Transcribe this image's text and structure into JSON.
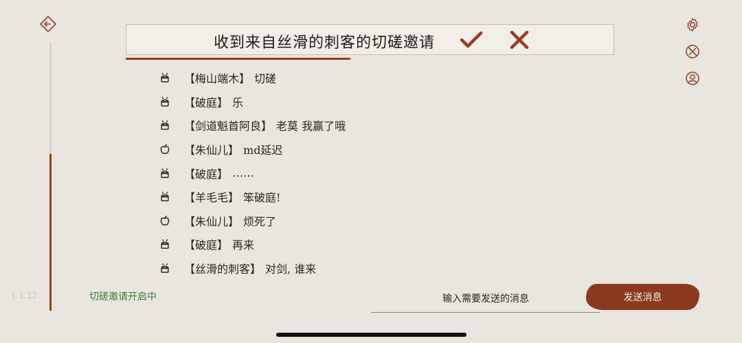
{
  "version": "1.1.12",
  "status_text": "切磋邀请开启中",
  "invite_banner": {
    "text": "收到来自丝滑的刺客的切磋邀请",
    "accept_icon": "check-icon",
    "reject_icon": "cross-icon"
  },
  "icons": {
    "back": "back-arrow-icon",
    "settings": "gear-icon",
    "duel_off": "crossed-swords-off-icon",
    "profile": "user-icon"
  },
  "chat": [
    {
      "device": "android",
      "name": "【梅山端木】",
      "text": "切磋"
    },
    {
      "device": "android",
      "name": "【破庭】",
      "text": "乐"
    },
    {
      "device": "android",
      "name": "【剑道魁首阿良】",
      "text": "老莫 我赢了哦"
    },
    {
      "device": "apple",
      "name": "【朱仙儿】",
      "text": "md延迟"
    },
    {
      "device": "android",
      "name": "【破庭】",
      "text": "……"
    },
    {
      "device": "android",
      "name": "【羊毛毛】",
      "text": "笨破庭!"
    },
    {
      "device": "apple",
      "name": "【朱仙儿】",
      "text": "烦死了"
    },
    {
      "device": "android",
      "name": "【破庭】",
      "text": "再来"
    },
    {
      "device": "android",
      "name": "【丝滑的刺客】",
      "text": "对剑, 谁来"
    }
  ],
  "input": {
    "placeholder": "输入需要发送的消息",
    "value": ""
  },
  "send_label": "发送消息",
  "colors": {
    "accent": "#9b3b22",
    "background": "#e9e6df",
    "status_green": "#3f7a3b",
    "send_button": "#8c3a1f"
  }
}
